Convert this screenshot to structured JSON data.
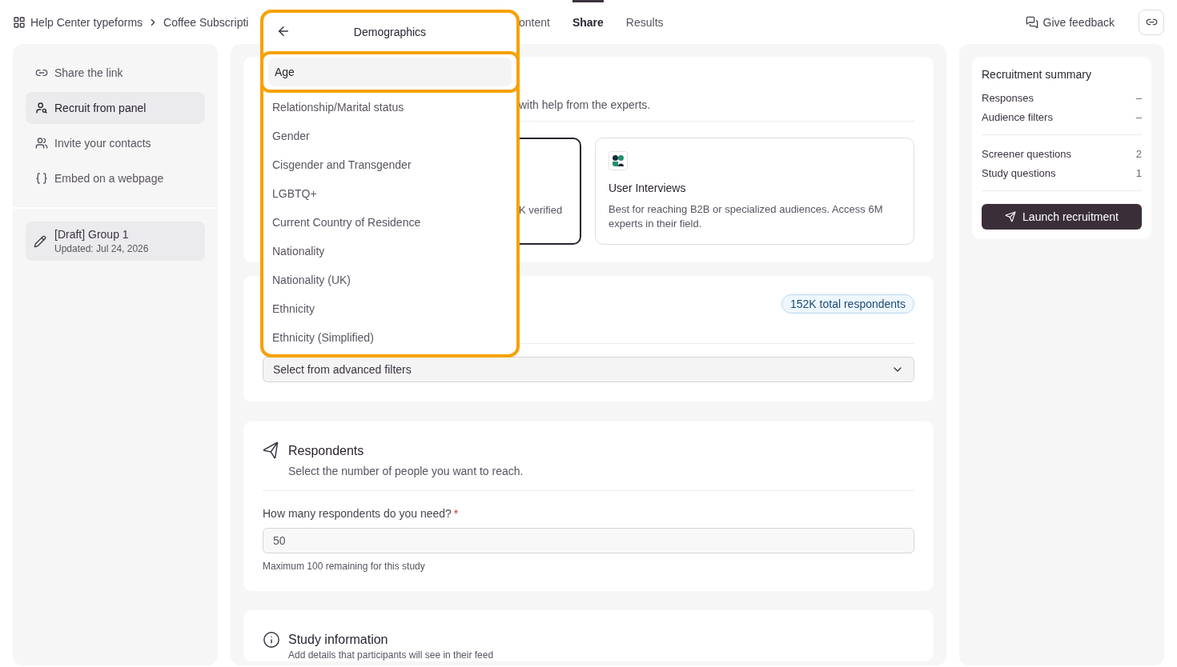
{
  "breadcrumb": {
    "items": [
      "Help Center typeforms",
      "Coffee Subscripti"
    ]
  },
  "tabs": [
    {
      "label": "ontent",
      "selected": false
    },
    {
      "label": "Share",
      "selected": true
    },
    {
      "label": "Results",
      "selected": false
    }
  ],
  "feedback": "Give feedback",
  "sidebar": {
    "items": [
      {
        "label": "Share the link",
        "selected": false
      },
      {
        "label": "Recruit from panel",
        "selected": true
      },
      {
        "label": "Invite your contacts",
        "selected": false
      },
      {
        "label": "Embed on a webpage",
        "selected": false
      }
    ],
    "group": {
      "title": "[Draft] Group 1",
      "updated": "Updated: Jul 24, 2026"
    }
  },
  "audience_card": {
    "subtitle": "with help from the experts.",
    "options": [
      {
        "description": "K verified",
        "selected": true
      },
      {
        "title": "User Interviews",
        "description": "Best for reaching B2B or specialized audiences. Access 6M experts in their field.",
        "selected": false
      }
    ]
  },
  "filters_card": {
    "badge": "152K total respondents",
    "select": "Select from advanced filters"
  },
  "respondents": {
    "title": "Respondents",
    "subtitle": "Select the number of people you want to reach.",
    "label": "How many respondents do you need?",
    "required_mark": "*",
    "value": "50",
    "hint": "Maximum 100 remaining for this study"
  },
  "study_info": {
    "title": "Study information",
    "subtitle": "Add details that participants will see in their feed"
  },
  "summary": {
    "title": "Recruitment summary",
    "groups": [
      [
        {
          "label": "Responses",
          "value": "–"
        },
        {
          "label": "Audience filters",
          "value": "–"
        }
      ],
      [
        {
          "label": "Screener questions",
          "value": "2"
        },
        {
          "label": "Study questions",
          "value": "1"
        }
      ]
    ],
    "button": "Launch recruitment"
  },
  "dropdown": {
    "title": "Demographics",
    "items": [
      {
        "label": "Age",
        "selected": true
      },
      {
        "label": "Relationship/Marital status",
        "selected": false
      },
      {
        "label": "Gender",
        "selected": false
      },
      {
        "label": "Cisgender and Transgender",
        "selected": false
      },
      {
        "label": "LGBTQ+",
        "selected": false
      },
      {
        "label": "Current Country of Residence",
        "selected": false
      },
      {
        "label": "Nationality",
        "selected": false
      },
      {
        "label": "Nationality (UK)",
        "selected": false
      },
      {
        "label": "Ethnicity",
        "selected": false
      },
      {
        "label": "Ethnicity (Simplified)",
        "selected": false
      }
    ]
  }
}
